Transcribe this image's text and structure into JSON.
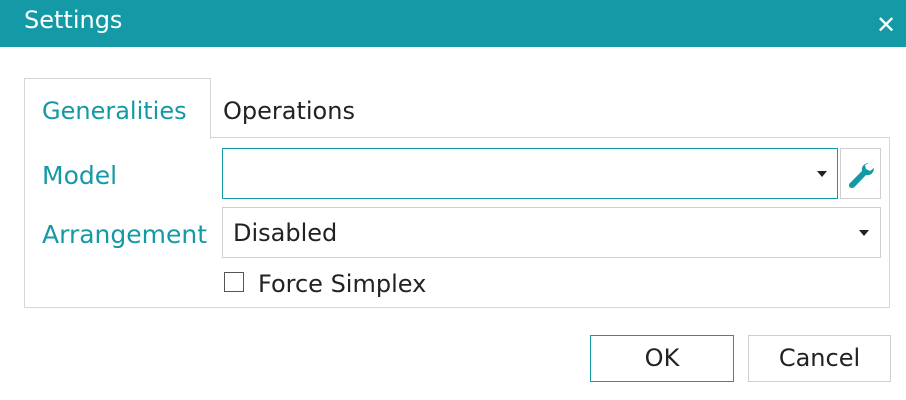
{
  "window": {
    "title": "Settings",
    "close_icon": "close-icon"
  },
  "tabs": [
    {
      "label": "Generalities",
      "active": true
    },
    {
      "label": "Operations",
      "active": false
    }
  ],
  "form": {
    "model": {
      "label": "Model",
      "value": "",
      "tool_icon": "wrench-icon"
    },
    "arrangement": {
      "label": "Arrangement",
      "value": "Disabled"
    },
    "force_simplex": {
      "label": "Force Simplex",
      "checked": false
    }
  },
  "buttons": {
    "ok": "OK",
    "cancel": "Cancel"
  },
  "colors": {
    "accent": "#139aa6",
    "border": "#cfcfcf",
    "text": "#222222"
  }
}
